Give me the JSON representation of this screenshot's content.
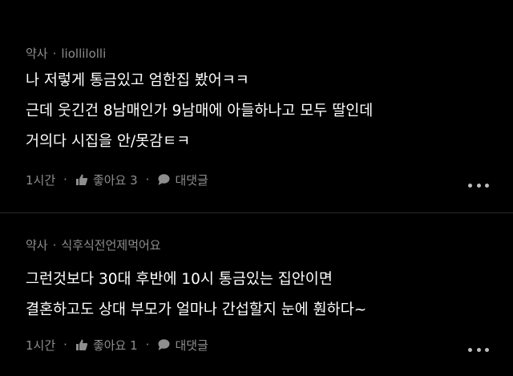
{
  "comments": [
    {
      "author": "약사",
      "nickname": "liollilolli",
      "lines": [
        "나 저렇게 통금있고 엄한집 봤어ㅋㅋ",
        "근데 웃긴건 8남매인가 9남매에 아들하나고 모두 딸인데",
        "거의다 시집을 안/못감ㅌㅋ"
      ],
      "time": "1시간",
      "like_label": "좋아요 3",
      "reply_label": "대댓글"
    },
    {
      "author": "약사",
      "nickname": "식후식전언제먹어요",
      "lines": [
        "그런것보다 30대 후반에 10시 통금있는 집안이면",
        "결혼하고도 상대 부모가 얼마나 간섭할지 눈에 훤하다~"
      ],
      "time": "1시간",
      "like_label": "좋아요 1",
      "reply_label": "대댓글"
    }
  ],
  "icons": {
    "like": "thumbs-up-icon",
    "reply": "speech-bubble-icon",
    "more": "more-dots-icon"
  },
  "colors": {
    "background": "#000000",
    "text": "#ffffff",
    "meta": "#8e8e8e"
  }
}
